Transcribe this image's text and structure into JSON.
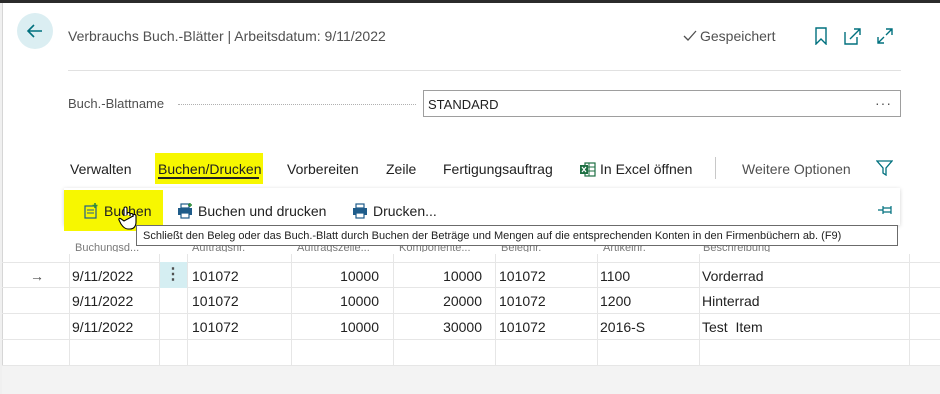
{
  "header": {
    "page_title": "Verbrauchs Buch.-Blätter | Arbeitsdatum: 9/11/2022",
    "saved_status": "Gespeichert"
  },
  "field": {
    "label": "Buch.-Blattname",
    "value": "STANDARD",
    "more": "···"
  },
  "menu": {
    "verwalten": "Verwalten",
    "buchen_drucken": "Buchen/Drucken",
    "vorbereiten": "Vorbereiten",
    "zeile": "Zeile",
    "fertigungsauftrag": "Fertigungsauftrag",
    "excel": "In Excel öffnen",
    "weitere": "Weitere Optionen"
  },
  "actions": {
    "buchen": "Buchen",
    "buchen_drucken": "Buchen und drucken",
    "drucken": "Drucken..."
  },
  "tooltip": "Schließt den Beleg oder das Buch.-Blatt durch Buchen der Beträge und Mengen auf die entsprechenden Konten in den Firmenbüchern ab. (F9)",
  "columns": {
    "c1": "Buchungsd...",
    "c2": "Auftragsnr.",
    "c3": "Auftragszeile...",
    "c4": "Komponente...",
    "c5": "Belegnr.",
    "c6": "Artikelnr.",
    "c7": "Beschreibung"
  },
  "rows": [
    {
      "date": "9/11/2022",
      "order": "101072",
      "line": "10000",
      "comp": "10000",
      "doc": "101072",
      "item": "1100",
      "desc": "Vorderrad"
    },
    {
      "date": "9/11/2022",
      "order": "101072",
      "line": "10000",
      "comp": "20000",
      "doc": "101072",
      "item": "1200",
      "desc": "Hinterrad"
    },
    {
      "date": "9/11/2022",
      "order": "101072",
      "line": "10000",
      "comp": "30000",
      "doc": "101072",
      "item": "2016-S",
      "desc": "Test  Item"
    }
  ],
  "colors": {
    "highlight": "#f7f700",
    "accent": "#00707e",
    "row_menu_bg": "#d5eef2"
  }
}
